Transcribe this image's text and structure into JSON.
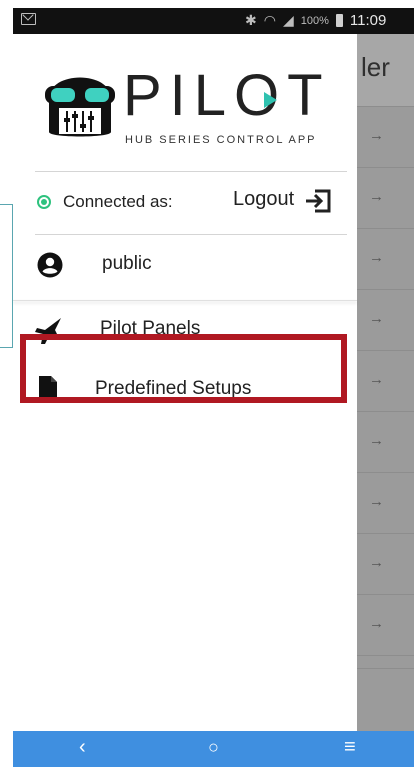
{
  "status_bar": {
    "battery_percent": "100%",
    "time": "11:09",
    "icons": [
      "mail-icon",
      "bluetooth-icon",
      "wifi-icon",
      "signal-icon",
      "battery-icon"
    ]
  },
  "background_screen": {
    "title_fragment": "ler",
    "row_arrows": [
      "→",
      "→",
      "→",
      "→",
      "→",
      "→",
      "→",
      "→",
      "→"
    ]
  },
  "drawer": {
    "logo": {
      "title": "PILOT",
      "subtitle": "HUB SERIES CONTROL APP"
    },
    "connection": {
      "label": "Connected as:",
      "logout_label": "Logout"
    },
    "user": {
      "name": "public"
    },
    "menu": [
      {
        "label": "Pilot Panels",
        "icon": "fighter-jet-icon"
      },
      {
        "label": "Predefined Setups",
        "icon": "file-icon"
      }
    ]
  },
  "colors": {
    "connected": "#2ec27e",
    "highlight": "#b01822",
    "nav_bar": "#3f8fe0"
  },
  "nav_bar": {
    "back": "‹",
    "home": "○",
    "menu": "≡"
  }
}
